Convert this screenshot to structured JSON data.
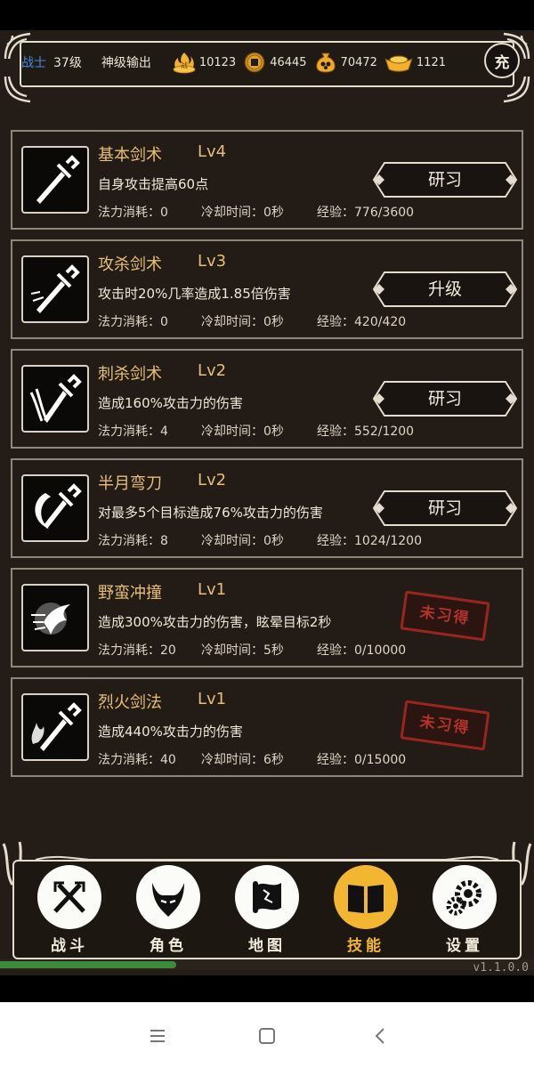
{
  "header": {
    "class_name": "战士",
    "level": "37级",
    "title": "神级输出",
    "resources": [
      {
        "icon": "flame-ingot-icon",
        "value": "10123"
      },
      {
        "icon": "copper-coin-icon",
        "value": "46445"
      },
      {
        "icon": "gold-pouch-icon",
        "value": "70472"
      },
      {
        "icon": "gold-ingot-icon",
        "value": "1121"
      }
    ],
    "charge_label": "充"
  },
  "skills": [
    {
      "name": "基本剑术",
      "level": "Lv4",
      "desc": "自身攻击提高60点",
      "mp": "法力消耗：0",
      "cd": "冷却时间：0秒",
      "exp": "经验：776/3600",
      "action": "研习",
      "learned": true,
      "icon": "sword-icon"
    },
    {
      "name": "攻杀剑术",
      "level": "Lv3",
      "desc": "攻击时20%几率造成1.85倍伤害",
      "mp": "法力消耗：0",
      "cd": "冷却时间：0秒",
      "exp": "经验：420/420",
      "action": "升级",
      "learned": true,
      "icon": "sword-strike-icon"
    },
    {
      "name": "刺杀剑术",
      "level": "Lv2",
      "desc": "造成160%攻击力的伤害",
      "mp": "法力消耗：4",
      "cd": "冷却时间：0秒",
      "exp": "经验：552/1200",
      "action": "研习",
      "learned": true,
      "icon": "sword-thrust-icon"
    },
    {
      "name": "半月弯刀",
      "level": "Lv2",
      "desc": "对最多5个目标造成76%攻击力的伤害",
      "mp": "法力消耗：8",
      "cd": "冷却时间：0秒",
      "exp": "经验：1024/1200",
      "action": "研习",
      "learned": true,
      "icon": "crescent-blade-icon"
    },
    {
      "name": "野蛮冲撞",
      "level": "Lv1",
      "desc": "造成300%攻击力的伤害，眩晕目标2秒",
      "mp": "法力消耗：20",
      "cd": "冷却时间：5秒",
      "exp": "经验：0/10000",
      "action": "未习得",
      "learned": false,
      "icon": "charge-dash-icon"
    },
    {
      "name": "烈火剑法",
      "level": "Lv1",
      "desc": "造成440%攻击力的伤害",
      "mp": "法力消耗：40",
      "cd": "冷却时间：6秒",
      "exp": "经验：0/15000",
      "action": "未习得",
      "learned": false,
      "icon": "flame-sword-icon"
    }
  ],
  "nav": [
    {
      "label": "战斗",
      "icon": "crossed-swords-icon",
      "active": false
    },
    {
      "label": "角色",
      "icon": "horned-helmet-icon",
      "active": false
    },
    {
      "label": "地图",
      "icon": "map-scroll-icon",
      "active": false
    },
    {
      "label": "技能",
      "icon": "skill-book-icon",
      "active": true
    },
    {
      "label": "设置",
      "icon": "gears-icon",
      "active": false
    }
  ],
  "progress_fraction": 0.33,
  "version": "v1.1.0.0",
  "colors": {
    "panel_bg": "#231c16",
    "card_border": "#8e877c",
    "skill_title": "#e6bf74",
    "class_blue": "#4b8ad8",
    "active_nav": "#f2b631",
    "stamp_red": "#c0342a",
    "progress_green": "#3d8a3a"
  },
  "system_nav": [
    "menu-icon",
    "home-square-icon",
    "back-icon"
  ]
}
